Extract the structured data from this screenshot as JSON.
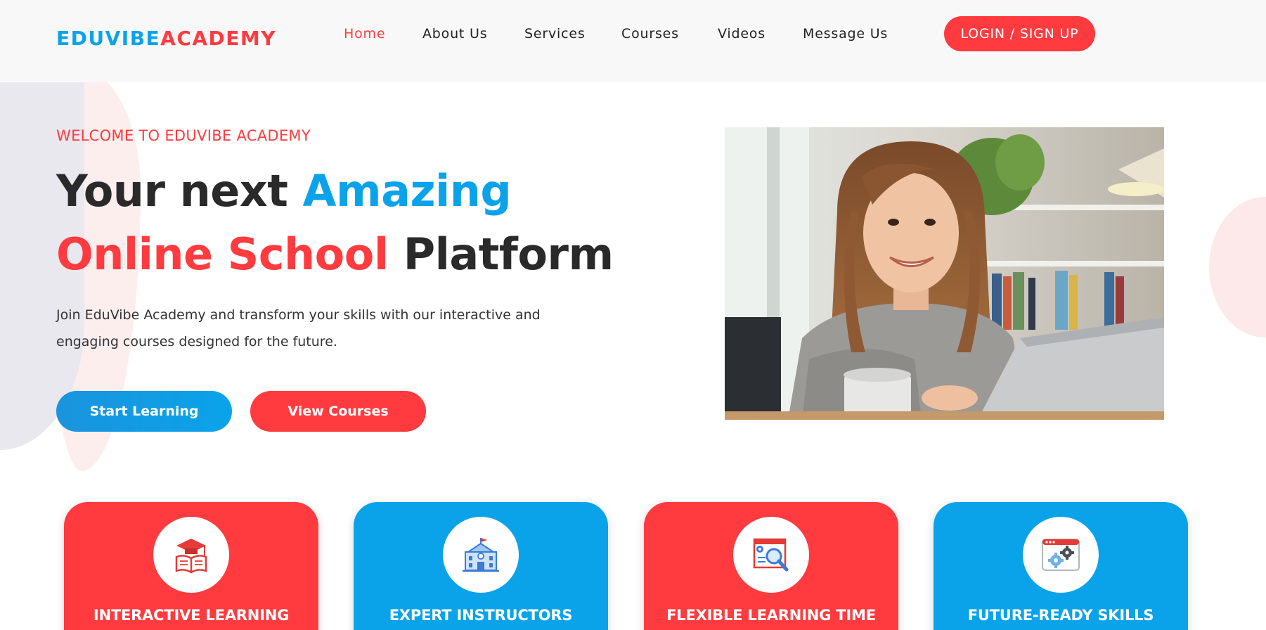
{
  "header": {
    "logo_part1": "EDUVIBE",
    "logo_part2": "ACADEMY",
    "nav": [
      {
        "label": "Home",
        "active": true
      },
      {
        "label": "About Us",
        "active": false
      },
      {
        "label": "Services",
        "active": false
      },
      {
        "label": "Courses",
        "active": false
      },
      {
        "label": "Videos",
        "active": false
      },
      {
        "label": "Message Us",
        "active": false
      }
    ],
    "login_label": "LOGIN / SIGN UP"
  },
  "hero": {
    "eyebrow": "WELCOME TO EDUVIBE ACADEMY",
    "headline_1": "Your next ",
    "headline_2": "Amazing",
    "headline_3": "Online School",
    "headline_4": " Platform",
    "lead": "Join EduVibe Academy and transform your skills with our interactive and engaging courses designed for the future.",
    "start_label": "Start Learning",
    "view_label": "View Courses"
  },
  "features": [
    {
      "title": "INTERACTIVE LEARNING",
      "icon": "graduation-book-icon"
    },
    {
      "title": "EXPERT INSTRUCTORS",
      "icon": "school-building-icon"
    },
    {
      "title": "FLEXIBLE LEARNING TIME",
      "icon": "magnifier-document-icon"
    },
    {
      "title": "FUTURE-READY SKILLS",
      "icon": "browser-gears-icon"
    }
  ],
  "colors": {
    "brand_blue": "#0aa3ea",
    "brand_red": "#ff3b3f"
  }
}
